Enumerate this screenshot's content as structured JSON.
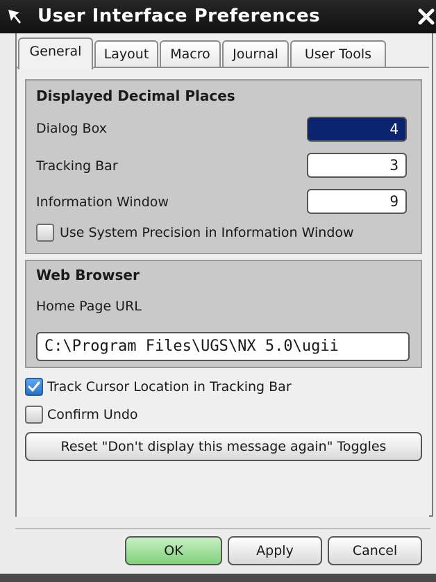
{
  "window": {
    "title": "User Interface Preferences"
  },
  "tabs": [
    {
      "label": "General",
      "active": true
    },
    {
      "label": "Layout",
      "active": false
    },
    {
      "label": "Macro",
      "active": false
    },
    {
      "label": "Journal",
      "active": false
    },
    {
      "label": "User Tools",
      "active": false
    }
  ],
  "decimal_places": {
    "title": "Displayed Decimal Places",
    "dialog_box": {
      "label": "Dialog Box",
      "value": "4"
    },
    "tracking_bar": {
      "label": "Tracking Bar",
      "value": "3"
    },
    "information_window": {
      "label": "Information Window",
      "value": "9"
    },
    "system_precision": {
      "label": "Use System Precision in Information Window",
      "checked": false
    }
  },
  "web_browser": {
    "title": "Web Browser",
    "home_page_label": "Home Page URL",
    "home_page_value": "C:\\Program Files\\UGS\\NX 5.0\\ugii"
  },
  "options": {
    "track_cursor": {
      "label": "Track Cursor Location in Tracking Bar",
      "checked": true
    },
    "confirm_undo": {
      "label": "Confirm Undo",
      "checked": false
    }
  },
  "reset_button": "Reset \"Don't display this message again\" Toggles",
  "buttons": {
    "ok": "OK",
    "apply": "Apply",
    "cancel": "Cancel"
  },
  "colors": {
    "selected_field": "#0a2470",
    "ok_button": "#7fd27a",
    "checkbox_checked": "#2673c7"
  }
}
